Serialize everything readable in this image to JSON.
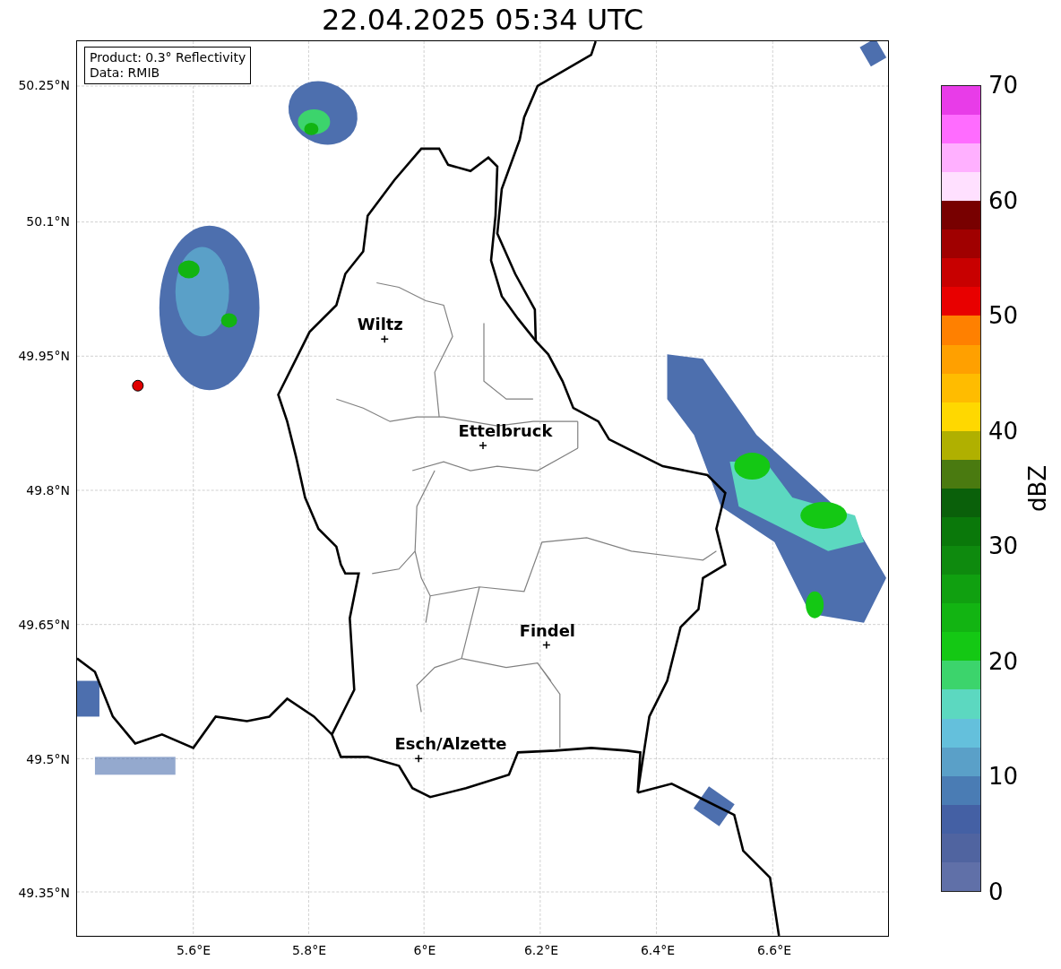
{
  "title": "22.04.2025 05:34 UTC",
  "info_box": [
    "Product: 0.3° Reflectivity",
    "Data: RMIB"
  ],
  "cities": [
    {
      "label": "Wiltz"
    },
    {
      "label": "Ettelbruck"
    },
    {
      "label": "Findel"
    },
    {
      "label": "Esch/Alzette"
    }
  ],
  "y_ticks": [
    "50.25°N",
    "50.1°N",
    "49.95°N",
    "49.8°N",
    "49.65°N",
    "49.5°N",
    "49.35°N"
  ],
  "x_ticks": [
    "5.6°E",
    "5.8°E",
    "6°E",
    "6.2°E",
    "6.4°E",
    "6.6°E"
  ],
  "colorbar": {
    "label": "dBZ",
    "ticks": [
      "70",
      "60",
      "50",
      "40",
      "30",
      "20",
      "10",
      "0"
    ],
    "bins": [
      {
        "color": "#6070a8"
      },
      {
        "color": "#5064a0"
      },
      {
        "color": "#4460a4"
      },
      {
        "color": "#4a7cb4"
      },
      {
        "color": "#5aa0c8"
      },
      {
        "color": "#64c0dc"
      },
      {
        "color": "#5cd8c0"
      },
      {
        "color": "#3cd46c"
      },
      {
        "color": "#14c814"
      },
      {
        "color": "#12b412"
      },
      {
        "color": "#10a010"
      },
      {
        "color": "#0e8a0e"
      },
      {
        "color": "#0a780a"
      },
      {
        "color": "#0a600a"
      },
      {
        "color": "#4a7a10"
      },
      {
        "color": "#b0b000"
      },
      {
        "color": "#ffd800"
      },
      {
        "color": "#ffbc00"
      },
      {
        "color": "#ffa000"
      },
      {
        "color": "#ff8000"
      },
      {
        "color": "#e80000"
      },
      {
        "color": "#c80000"
      },
      {
        "color": "#a00000"
      },
      {
        "color": "#780000"
      },
      {
        "color": "#ffe0ff"
      },
      {
        "color": "#ffb0ff"
      },
      {
        "color": "#ff6cff"
      },
      {
        "color": "#e83ce8"
      }
    ]
  }
}
